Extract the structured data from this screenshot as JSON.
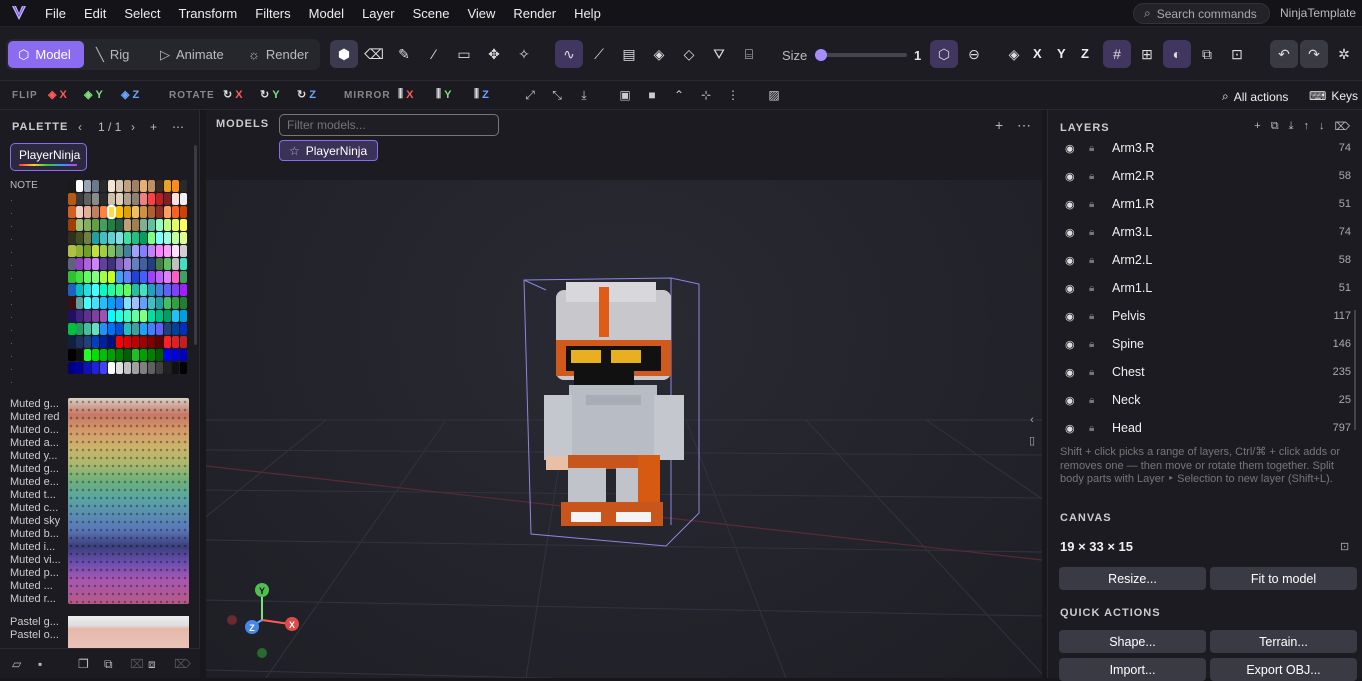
{
  "app": {
    "project": "NinjaTemplate"
  },
  "menu": [
    "File",
    "Edit",
    "Select",
    "Transform",
    "Filters",
    "Model",
    "Layer",
    "Scene",
    "View",
    "Render",
    "Help"
  ],
  "search": {
    "label": "Search commands"
  },
  "modes": [
    {
      "label": "Model",
      "icon": "cube-icon",
      "active": true
    },
    {
      "label": "Rig",
      "icon": "bone-icon",
      "active": false
    },
    {
      "label": "Animate",
      "icon": "play-icon",
      "active": false
    },
    {
      "label": "Render",
      "icon": "sun-icon",
      "active": false
    }
  ],
  "toolbar": {
    "size_label": "Size",
    "size_value": "1",
    "size_fraction": 0.0,
    "axes": [
      "X",
      "Y",
      "Z"
    ]
  },
  "subbar": {
    "flip": "FLIP",
    "rotate": "ROTATE",
    "mirror": "MIRROR",
    "x": "X",
    "y": "Y",
    "z": "Z",
    "all_actions": "All actions",
    "keys": "Keys"
  },
  "palette": {
    "title": "PALETTE",
    "page": "1 / 1",
    "active_name": "PlayerNinja",
    "note": "NOTE",
    "muted": [
      "Muted g...",
      "Muted red",
      "Muted o...",
      "Muted a...",
      "Muted y...",
      "Muted g...",
      "Muted e...",
      "Muted t...",
      "Muted c...",
      "Muted sky",
      "Muted b...",
      "Muted i...",
      "Muted vi...",
      "Muted p...",
      "Muted ...",
      "Muted r..."
    ],
    "pastel": [
      "Pastel g...",
      "Pastel o..."
    ],
    "swatch_colors": [
      "#1a1a1a",
      "#ffffff",
      "#9aa6b5",
      "#6a7a8a",
      "#2a2a2a",
      "#f5e6d0",
      "#d8c8b0",
      "#c0a080",
      "#a08060",
      "#e8b070",
      "#c09060",
      "#3a2a20",
      "#f0a020",
      "#ff8a20",
      "#2a2a2a",
      "#b85a10",
      "#3a3a3a",
      "#606060",
      "#8a8a8a",
      "#2a2a2a",
      "#d0c0a8",
      "#e0d0b8",
      "#b0a090",
      "#908070",
      "#f08080",
      "#ff4040",
      "#c02020",
      "#802020",
      "#ffe0e0",
      "#f0f0f0",
      "#d06020",
      "#f0d0c0",
      "#e0b090",
      "#c08060",
      "#ff8040",
      "#ffe040",
      "#ffc000",
      "#e0a000",
      "#f0c060",
      "#d09040",
      "#b06030",
      "#903020",
      "#ffa060",
      "#ff6020",
      "#d04000",
      "#a04000",
      "#a0c070",
      "#80b060",
      "#60a040",
      "#40a060",
      "#208040",
      "#206040",
      "#c0a070",
      "#a08050",
      "#80b090",
      "#60c0a0",
      "#90ffc0",
      "#c0ff80",
      "#e0ff60",
      "#ffff60",
      "#303020",
      "#405020",
      "#708040",
      "#20a0a0",
      "#40c0c0",
      "#60d0d0",
      "#80e0e0",
      "#40e0a0",
      "#20c080",
      "#00a060",
      "#80ff80",
      "#80ffff",
      "#a0ffe0",
      "#c0ffa0",
      "#e0ff90",
      "#b0c040",
      "#90b030",
      "#70a020",
      "#c0e040",
      "#a0d040",
      "#80c060",
      "#60a080",
      "#4080a0",
      "#a0a0ff",
      "#8080ff",
      "#c080ff",
      "#ff80ff",
      "#ffa0ff",
      "#ffe0ff",
      "#d0d0d0",
      "#606080",
      "#9040c0",
      "#b060e0",
      "#d080ff",
      "#6040a0",
      "#403080",
      "#8060c0",
      "#a080e0",
      "#6080c0",
      "#4060a0",
      "#204080",
      "#408040",
      "#60c060",
      "#c0c0c0",
      "#40e0c0",
      "#30c030",
      "#40e040",
      "#60ff60",
      "#80ff80",
      "#a0ff40",
      "#c0ff20",
      "#40a0ff",
      "#6080ff",
      "#2040e0",
      "#4060ff",
      "#a040ff",
      "#c060ff",
      "#e080ff",
      "#ff60c0",
      "#40a060",
      "#2060c0",
      "#00c0c0",
      "#20e0e0",
      "#40ffff",
      "#00ffc0",
      "#20ffa0",
      "#40ff80",
      "#60ff60",
      "#20c0a0",
      "#40e0c0",
      "#20a0c0",
      "#4080e0",
      "#6060ff",
      "#8040ff",
      "#a020ff",
      "#3a1010",
      "#60a0a0",
      "#40ffff",
      "#40e0ff",
      "#20c0ff",
      "#00a0ff",
      "#2080ff",
      "#80e0ff",
      "#a0c0ff",
      "#60a0ff",
      "#40c0c0",
      "#20a0a0",
      "#40c060",
      "#30a040",
      "#208030",
      "#201060",
      "#402080",
      "#603090",
      "#8040a0",
      "#a050b0",
      "#00ffff",
      "#20ffe0",
      "#40ffc0",
      "#60ffa0",
      "#80ff80",
      "#00e0a0",
      "#00c080",
      "#00a060",
      "#20c0ff",
      "#00a0e0",
      "#00c040",
      "#20a060",
      "#40c0a0",
      "#60e0c0",
      "#2090ff",
      "#0070ff",
      "#0050e0",
      "#20c0c0",
      "#40a0a0",
      "#20a0ff",
      "#4080ff",
      "#6060ff",
      "#204080",
      "#0040a0",
      "#0030c0",
      "#102040",
      "#203060",
      "#204080",
      "#0040c0",
      "#0020a0",
      "#001080",
      "#ff0000",
      "#e00000",
      "#c00000",
      "#a00000",
      "#800000",
      "#600000",
      "#ff2020",
      "#e02020",
      "#c02020",
      "#000000",
      "#101010",
      "#20ff20",
      "#00e000",
      "#00c000",
      "#00a000",
      "#008000",
      "#006000",
      "#20c020",
      "#00a000",
      "#008000",
      "#006000",
      "#0000ff",
      "#0000e0",
      "#0000c0",
      "#000080",
      "#0000a0",
      "#1010c0",
      "#2020e0",
      "#4040ff",
      "#ffffff",
      "#e0e0e0",
      "#c0c0c0",
      "#a0a0a0",
      "#808080",
      "#606060",
      "#404040",
      "#202020",
      "#101010",
      "#000000"
    ]
  },
  "models": {
    "title": "MODELS",
    "filter_placeholder": "Filter models...",
    "items": [
      {
        "label": "PlayerNinja",
        "icon": "star-icon"
      }
    ]
  },
  "layers": {
    "title": "LAYERS",
    "items": [
      {
        "name": "Arm3.R",
        "count": "74"
      },
      {
        "name": "Arm2.R",
        "count": "58"
      },
      {
        "name": "Arm1.R",
        "count": "51"
      },
      {
        "name": "Arm3.L",
        "count": "74"
      },
      {
        "name": "Arm2.L",
        "count": "58"
      },
      {
        "name": "Arm1.L",
        "count": "51"
      },
      {
        "name": "Pelvis",
        "count": "117"
      },
      {
        "name": "Spine",
        "count": "146"
      },
      {
        "name": "Chest",
        "count": "235"
      },
      {
        "name": "Neck",
        "count": "25"
      },
      {
        "name": "Head",
        "count": "797"
      }
    ],
    "hint": "Shift + click picks a range of layers, Ctrl/⌘ + click adds or removes one — then move or rotate them together. Split body parts with Layer ‣ Selection to new layer (Shift+L)."
  },
  "canvas": {
    "title": "CANVAS",
    "dimensions": "19 × 33 × 15",
    "resize": "Resize...",
    "fit": "Fit to model"
  },
  "quick": {
    "title": "QUICK ACTIONS",
    "shape": "Shape...",
    "terrain": "Terrain...",
    "import": "Import...",
    "export": "Export OBJ..."
  },
  "gizmo": {
    "x": "X",
    "y": "Y",
    "z": "Z"
  },
  "colors": {
    "accent": "#8b6cf0",
    "x_axis": "#ff5a5a",
    "y_axis": "#7ee07e",
    "z_axis": "#6aa6ff"
  }
}
